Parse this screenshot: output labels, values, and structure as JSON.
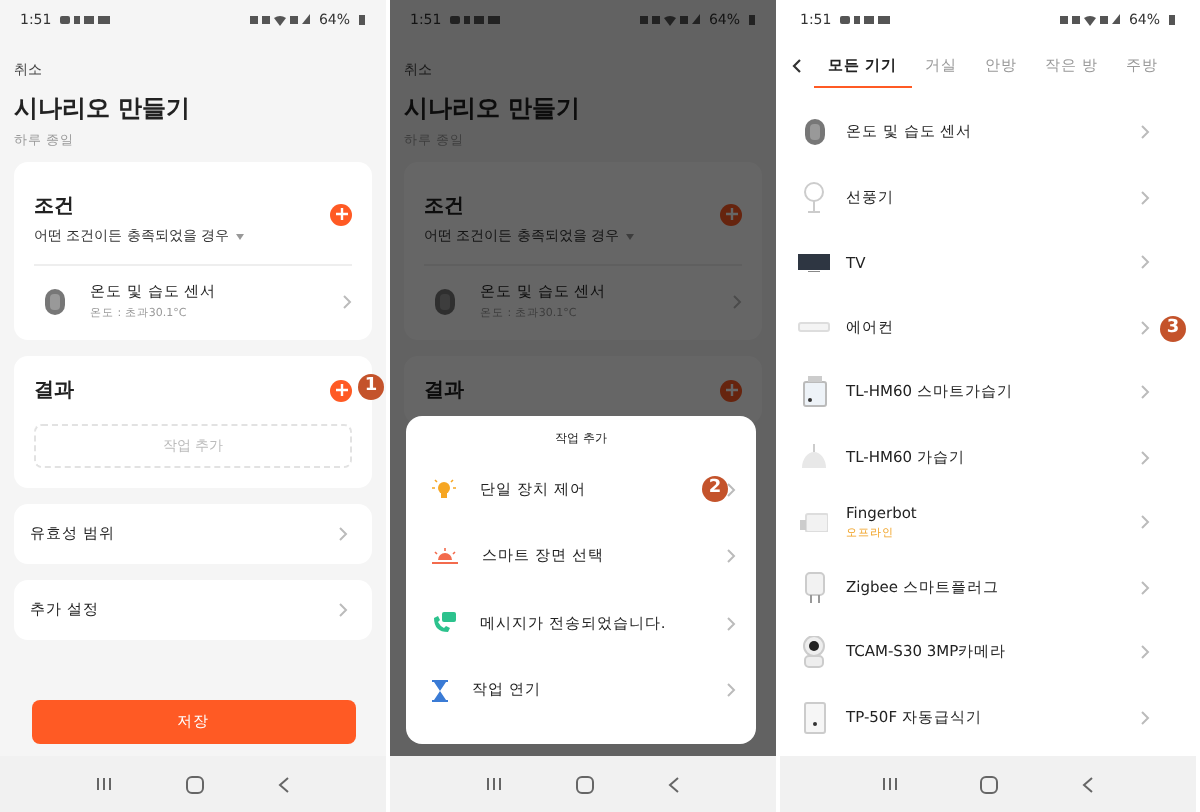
{
  "screens": [
    {
      "kind": "scenario",
      "dimmed": false,
      "status_bar": {
        "time": "1:51",
        "battery": "64%"
      },
      "cancel": "취소",
      "title": "시나리오 만들기",
      "subtitle": "하루 종일",
      "condition": {
        "title": "조건",
        "mode": "어떤 조건이든 충족되었을 경우",
        "device": {
          "name": "온도 및 습도 센서",
          "detail": "온도 : 초과30.1°C"
        }
      },
      "result": {
        "title": "결과",
        "badge": "1",
        "add_action": "작업 추가"
      },
      "rows": [
        "유효성 범위",
        "추가 설정"
      ],
      "save": "저장"
    },
    {
      "kind": "scenario",
      "dimmed": true,
      "status_bar": {
        "time": "1:51",
        "battery": "64%"
      },
      "cancel": "취소",
      "title": "시나리오 만들기",
      "subtitle": "하루 종일",
      "condition": {
        "title": "조건",
        "mode": "어떤 조건이든 충족되었을 경우",
        "device": {
          "name": "온도 및 습도 센서",
          "detail": "온도 : 초과30.1°C"
        }
      },
      "result": {
        "title": "결과"
      },
      "sheet": {
        "title": "작업 추가",
        "items": [
          {
            "kind": "bulb",
            "label": "단일 장치 제어",
            "badge": "2"
          },
          {
            "kind": "scene",
            "label": "스마트 장면 선택"
          },
          {
            "kind": "message",
            "label": "메시지가 전송되었습니다."
          },
          {
            "kind": "delay",
            "label": "작업 연기"
          }
        ]
      }
    },
    {
      "kind": "devices",
      "status_bar": {
        "time": "1:51",
        "battery": "64%"
      },
      "tabs": [
        {
          "label": "모든 기기",
          "selected": true
        },
        {
          "label": "거실",
          "selected": false
        },
        {
          "label": "안방",
          "selected": false
        },
        {
          "label": "작은 방",
          "selected": false
        },
        {
          "label": "주방",
          "selected": false
        }
      ],
      "devices": [
        {
          "kind": "sensor",
          "name": "온도 및 습도 센서"
        },
        {
          "kind": "fan",
          "name": "선풍기"
        },
        {
          "kind": "tv",
          "name": "TV"
        },
        {
          "kind": "aircon",
          "name": "에어컨",
          "badge": "3"
        },
        {
          "kind": "humidifier",
          "name": "TL-HM60 스마트가습기"
        },
        {
          "kind": "diffuser",
          "name": "TL-HM60 가습기"
        },
        {
          "kind": "bot",
          "name": "Fingerbot",
          "status": "오프라인"
        },
        {
          "kind": "plug",
          "name": "Zigbee 스마트플러그"
        },
        {
          "kind": "camera",
          "name": "TCAM-S30 3MP카메라"
        },
        {
          "kind": "feeder",
          "name": "TP-50F 자동급식기"
        }
      ]
    }
  ]
}
